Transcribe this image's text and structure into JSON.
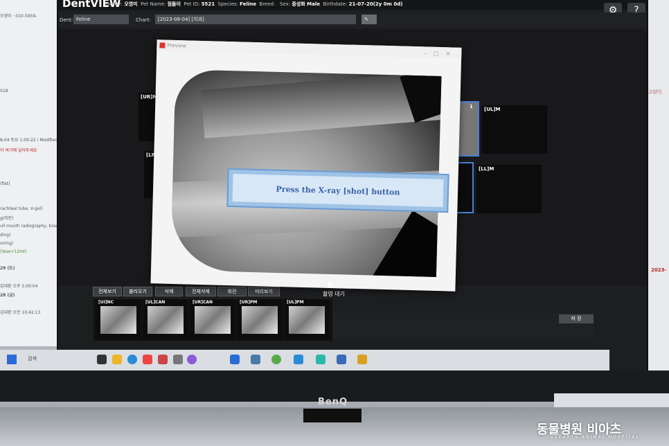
{
  "app": {
    "logo": "DentVIEW",
    "owner_label": "Owner:",
    "owner": "오영미",
    "pet_name_label": "Pet Name:",
    "pet_name": "점돌이",
    "pet_id_label": "Pet ID:",
    "pet_id": "5521",
    "species_label": "Species:",
    "species": "Feline",
    "breed_label": "Breed:",
    "breed": "",
    "sex_label": "Sex:",
    "sex": "중성화 Male",
    "birthdate_label": "Birthdate:",
    "birthdate": "21-07-20(2y 0m 0d)"
  },
  "toolbar": {
    "dent_label": "Dent:",
    "dent_value": "Feline",
    "chart_label": "Chart:",
    "chart_value": "[2023-08-04] [치과]"
  },
  "slots": [
    "[UR]M",
    "[LR]M",
    "[UL]M",
    "[LL]M",
    "1"
  ],
  "dialog": {
    "title": "Preview",
    "shot_message": "Press the X-ray [shot] button"
  },
  "status": "촬영 대기",
  "buttons": [
    "전체보기",
    "불러오기",
    "삭제",
    "전체삭제",
    "회전",
    "미리보기"
  ],
  "thumbnails": [
    "[UI]NC",
    "[UL]CAN",
    "[UR]CAN",
    "[UR]PM",
    "[UL]PM"
  ],
  "save_label": "저 장",
  "taskbar": {
    "search": "검색"
  },
  "monitor_brand": "BenQ",
  "watermark": {
    "main": "동물병원 비아츠",
    "sub": "VEEARTS ANIMAL HOSPITAL"
  },
  "bg_left": [
    "오영미 · 010-5959-",
    "018",
    "8-04 토요 1:00:22 / Modified: 김대환",
    "이 여기에 넣어주세요",
    "(flat)",
    "rachteal tube, V-gel)",
    "g(미란)",
    "ull mouth radiography, brachy)",
    "ding)",
    "oning)",
    "(Yase+12ml)",
    "29 (도)",
    "김대환 오후 5:00:04",
    "28 (금)",
    "김대환 오전 10:42:13"
  ],
  "bg_right": [
    "2023-07-28",
    "2023-",
    "고양이"
  ]
}
